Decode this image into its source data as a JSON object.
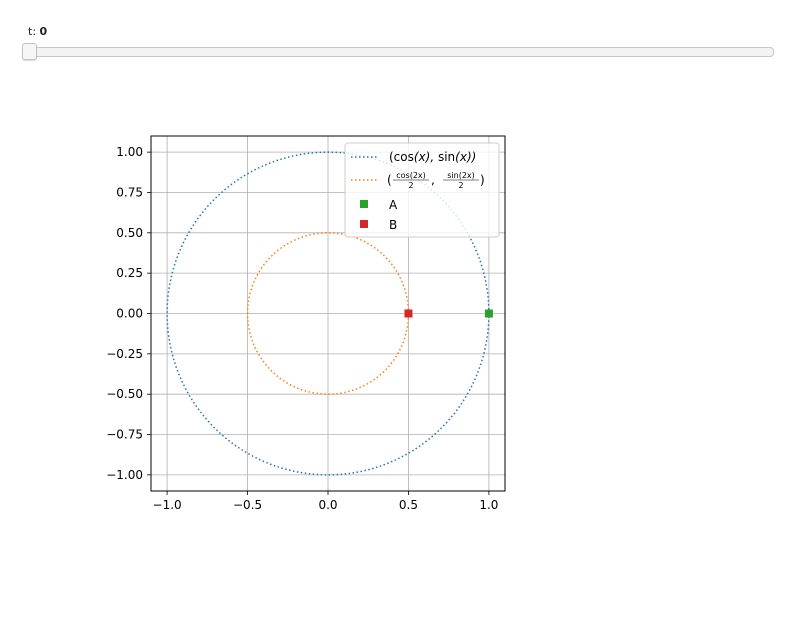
{
  "slider": {
    "label": "t:",
    "value": "0",
    "fraction": 0
  },
  "chart_data": {
    "type": "line",
    "title": "",
    "xlabel": "",
    "ylabel": "",
    "xlim": [
      -1.1,
      1.1
    ],
    "ylim": [
      -1.1,
      1.1
    ],
    "grid": true,
    "legend_position": "upper right",
    "xticks": [
      "−1.0",
      "−0.5",
      "0.0",
      "0.5",
      "1.0"
    ],
    "xtick_values": [
      -1.0,
      -0.5,
      0.0,
      0.5,
      1.0
    ],
    "yticks": [
      "1.00",
      "0.75",
      "0.50",
      "0.25",
      "0.00",
      "−0.25",
      "−0.50",
      "−0.75",
      "−1.00"
    ],
    "ytick_values": [
      1.0,
      0.75,
      0.5,
      0.25,
      0.0,
      -0.25,
      -0.5,
      -0.75,
      -1.0
    ],
    "series": [
      {
        "name": "(cos(x), sin(x))",
        "kind": "parametric-circle",
        "radius": 1.0,
        "center": [
          0,
          0
        ],
        "color": "#1f77b4",
        "style": "dotted"
      },
      {
        "name": "(cos(2x)/2, sin(2x)/2)",
        "kind": "parametric-circle",
        "radius": 0.5,
        "center": [
          0,
          0
        ],
        "color": "#ff7f0e",
        "style": "dotted"
      },
      {
        "name": "A",
        "kind": "point",
        "x": 1.0,
        "y": 0.0,
        "color": "#2ca02c",
        "marker": "square"
      },
      {
        "name": "B",
        "kind": "point",
        "x": 0.5,
        "y": 0.0,
        "color": "#d62728",
        "marker": "square"
      }
    ],
    "legend": {
      "entry1": {
        "open": "(cos",
        "x1": "(x), ",
        "mid": "sin",
        "x2": "(x))"
      },
      "entry2": {
        "num1": "cos(2x)",
        "den1": "2",
        "num2": "sin(2x)",
        "den2": "2"
      },
      "entry3": "A",
      "entry4": "B"
    }
  }
}
